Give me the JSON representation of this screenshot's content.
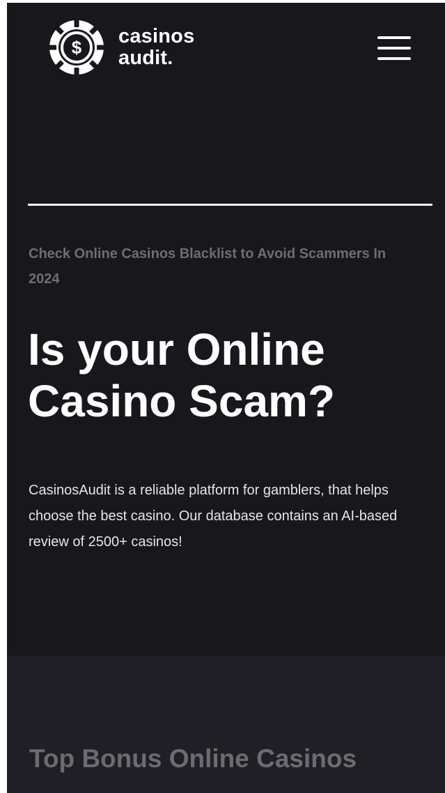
{
  "header": {
    "logo": {
      "line1": "casinos",
      "line2": "audit.",
      "icon": "dollar-chip-icon"
    },
    "menu_icon": "hamburger-menu-icon"
  },
  "hero": {
    "eyebrow": "Check Online Casinos Blacklist to Avoid Scammers In 2024",
    "title": "Is your Online Casino Scam?",
    "description": "CasinosAudit is a reliable platform for gamblers, that helps choose the best casino. Our database contains an AI-based review of 2500+ casinos!"
  },
  "top_bonus_section": {
    "title": "Top Bonus Online Casinos"
  },
  "colors": {
    "background": "#17171c",
    "section_background": "#1f1f25",
    "text_primary": "#ffffff",
    "text_muted": "#6d6d73"
  }
}
